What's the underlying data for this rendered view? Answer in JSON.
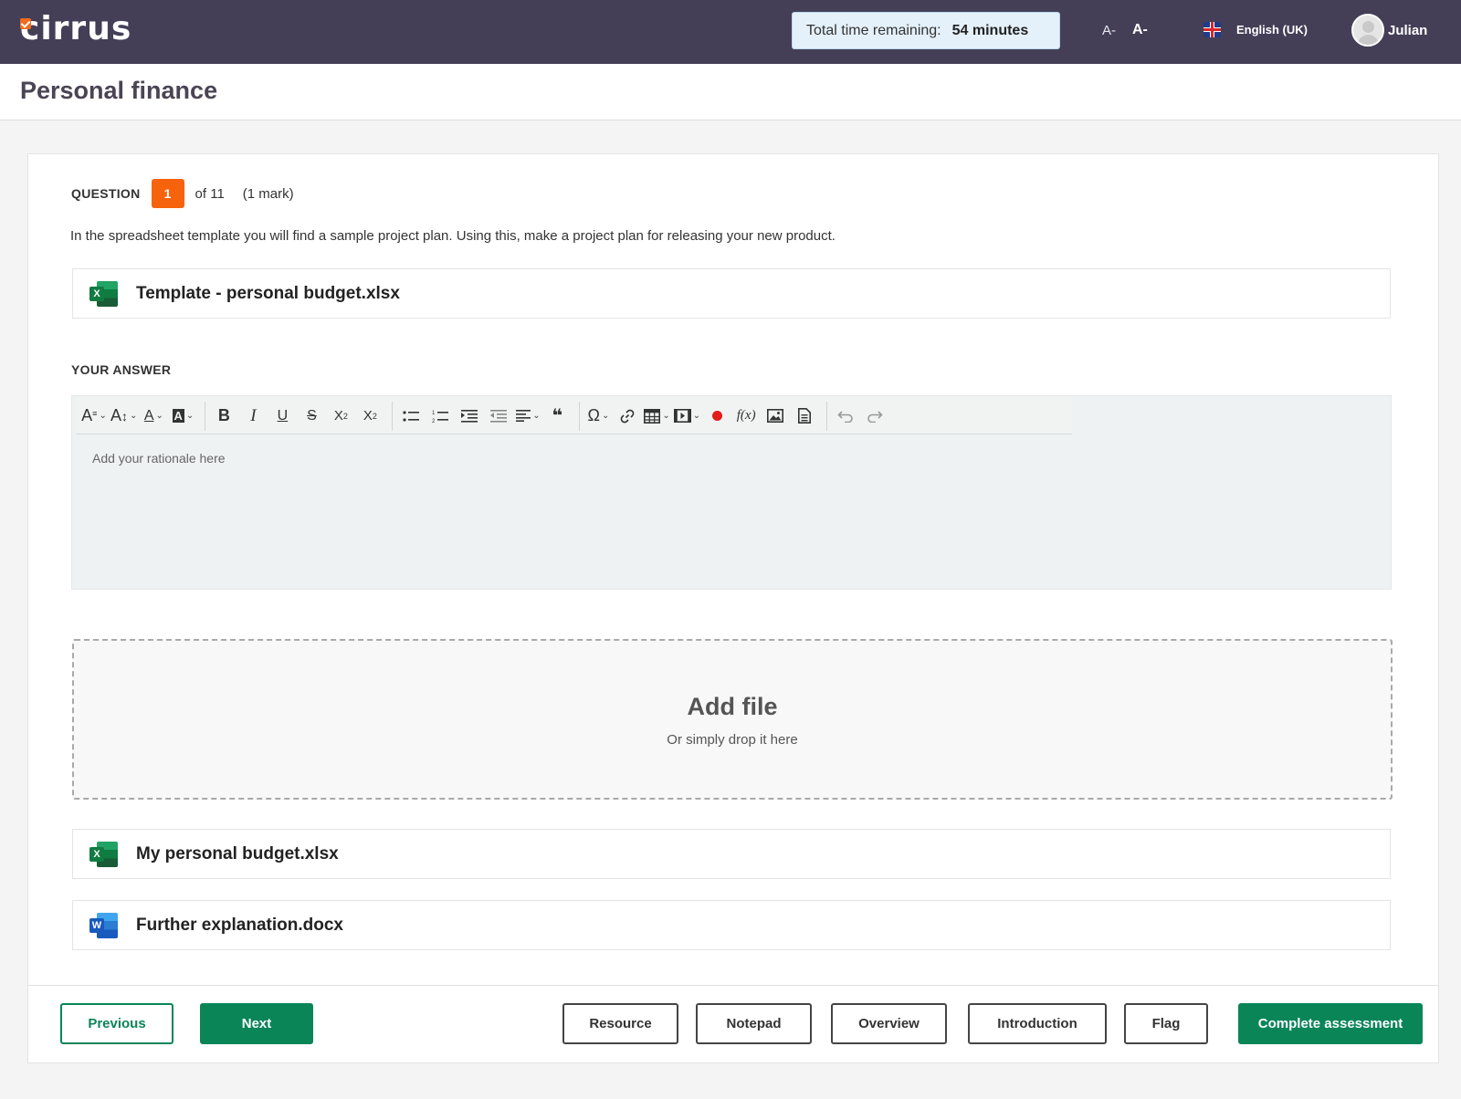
{
  "header": {
    "logo_text": "cirrus",
    "timer_label": "Total time remaining:",
    "timer_value": "54 minutes",
    "font_decrease": "A-",
    "font_increase": "A-",
    "language": "English (UK)",
    "user_name": "Julian"
  },
  "page": {
    "title": "Personal finance"
  },
  "question": {
    "label": "QUESTION",
    "number": "1",
    "of_total": "of 11",
    "marks": "(1 mark)",
    "text": "In the spreadsheet template you will find a sample project plan. Using this, make a project plan for releasing your new product."
  },
  "template_file": {
    "name": "Template - personal budget.xlsx",
    "icon": "excel-icon",
    "badge": "X"
  },
  "answer": {
    "label": "YOUR ANSWER",
    "placeholder": "Add your rationale here"
  },
  "toolbar": {
    "font_family": "A",
    "font_size": "A",
    "font_color": "A",
    "bg_color": "A",
    "bold": "B",
    "italic": "I",
    "underline": "U",
    "strike": "S",
    "subscript": "X",
    "superscript": "X",
    "blockquote": "❝",
    "special_char": "Ω",
    "formula": "f(x)"
  },
  "dropzone": {
    "title": "Add file",
    "subtitle": "Or simply drop it here"
  },
  "uploaded_files": [
    {
      "name": "My personal budget.xlsx",
      "icon": "excel-icon",
      "badge": "X"
    },
    {
      "name": "Further explanation.docx",
      "icon": "word-icon",
      "badge": "W"
    }
  ],
  "footer": {
    "previous": "Previous",
    "next": "Next",
    "resource": "Resource",
    "notepad": "Notepad",
    "overview": "Overview",
    "introduction": "Introduction",
    "flag": "Flag",
    "complete": "Complete assessment"
  },
  "colors": {
    "header_bg": "#443f57",
    "accent_orange": "#f7630c",
    "primary_green": "#0a8558",
    "record_red": "#e31c1c"
  }
}
